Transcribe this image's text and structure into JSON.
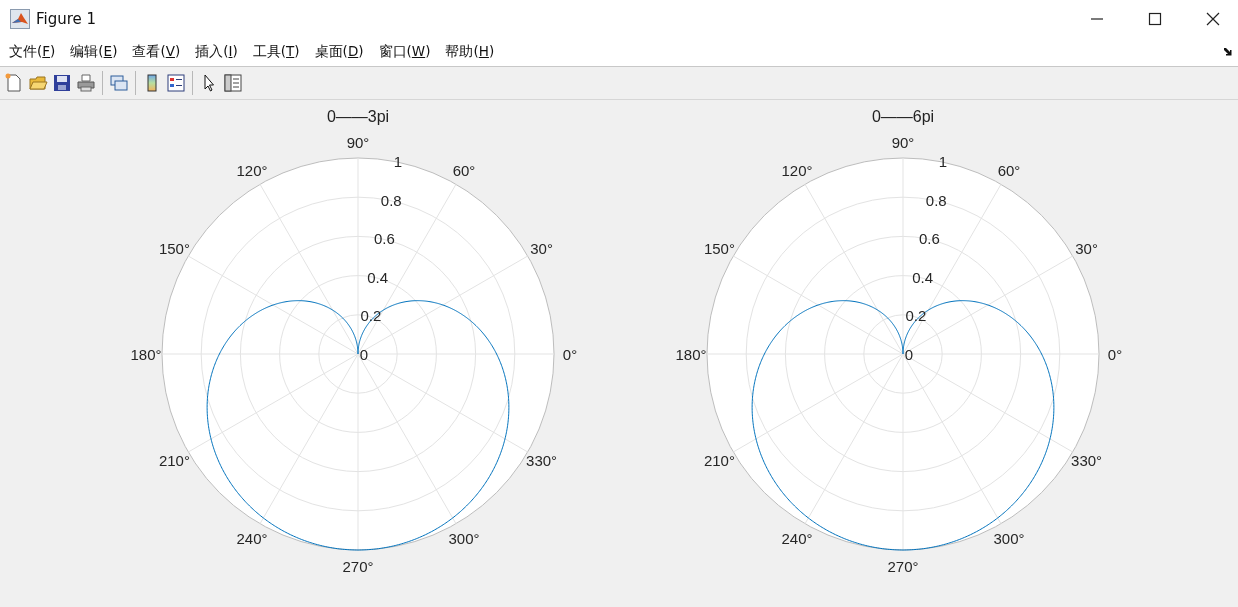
{
  "window": {
    "title": "Figure 1"
  },
  "menu": [
    {
      "before": "文件(",
      "key": "F",
      "after": ")"
    },
    {
      "before": "编辑(",
      "key": "E",
      "after": ")"
    },
    {
      "before": "查看(",
      "key": "V",
      "after": ")"
    },
    {
      "before": "插入(",
      "key": "I",
      "after": ")"
    },
    {
      "before": "工具(",
      "key": "T",
      "after": ")"
    },
    {
      "before": "桌面(",
      "key": "D",
      "after": ")"
    },
    {
      "before": "窗口(",
      "key": "W",
      "after": ")"
    },
    {
      "before": "帮助(",
      "key": "H",
      "after": ")"
    }
  ],
  "plots": [
    {
      "title": "0——3pi",
      "angle_labels": [
        "0°",
        "30°",
        "60°",
        "90°",
        "120°",
        "150°",
        "180°",
        "210°",
        "240°",
        "270°",
        "300°",
        "330°"
      ],
      "radius_labels": [
        "1",
        "0.8",
        "0.6",
        "0.4",
        "0.2",
        "0"
      ]
    },
    {
      "title": "0——6pi",
      "angle_labels": [
        "0°",
        "30°",
        "60°",
        "90°",
        "120°",
        "150°",
        "180°",
        "210°",
        "240°",
        "270°",
        "300°",
        "330°"
      ],
      "radius_labels": [
        "1",
        "0.8",
        "0.6",
        "0.4",
        "0.2",
        "0"
      ]
    }
  ]
}
